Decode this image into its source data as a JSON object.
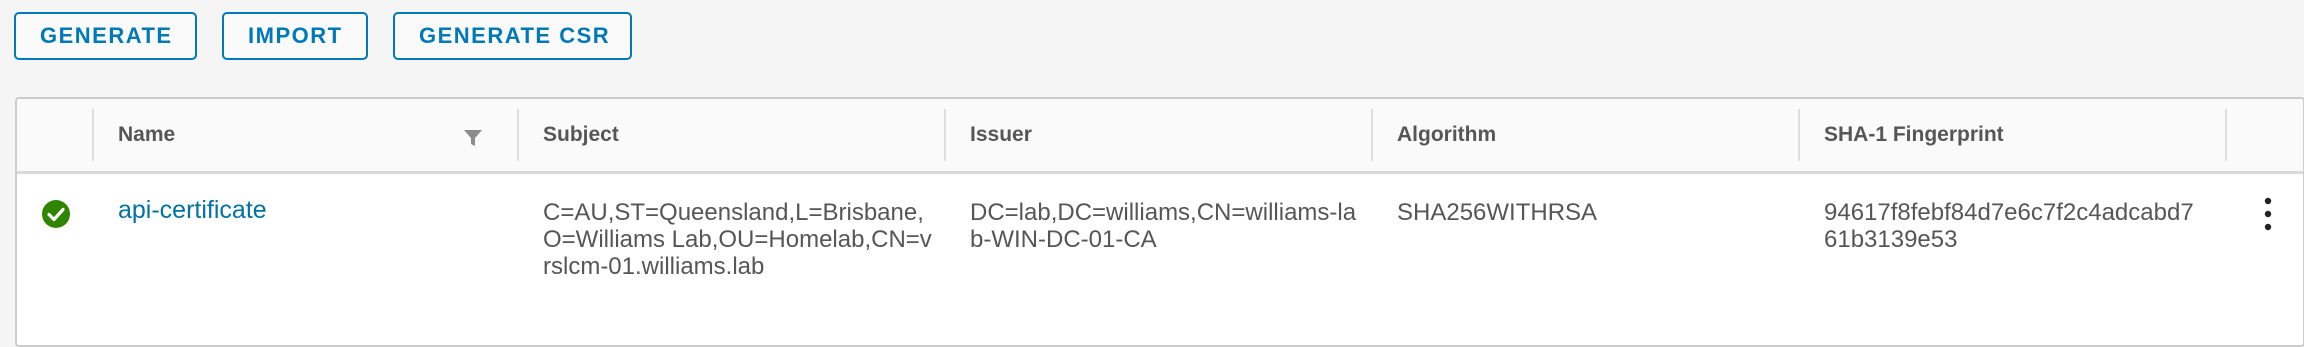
{
  "toolbar": {
    "generate_label": "GENERATE",
    "import_label": "IMPORT",
    "generate_csr_label": "GENERATE CSR"
  },
  "table": {
    "columns": {
      "name": "Name",
      "subject": "Subject",
      "issuer": "Issuer",
      "algorithm": "Algorithm",
      "fingerprint": "SHA-1 Fingerprint"
    },
    "rows": [
      {
        "status": "success",
        "name": "api-certificate",
        "subject": "C=AU,ST=Queensland,L=Brisbane,O=Williams Lab,OU=Homelab,CN=vrslcm-01.williams.lab",
        "issuer": "DC=lab,DC=williams,CN=williams-lab-WIN-DC-01-CA",
        "algorithm": "SHA256WITHRSA",
        "fingerprint": "94617f8febf84d7e6c7f2c4adcabd761b3139e53"
      }
    ]
  },
  "colors": {
    "accent": "#0079b8",
    "link": "#0072a3",
    "success": "#2f8400"
  },
  "icons": [
    "filter-icon",
    "success-check-icon",
    "more-vertical-icon"
  ]
}
